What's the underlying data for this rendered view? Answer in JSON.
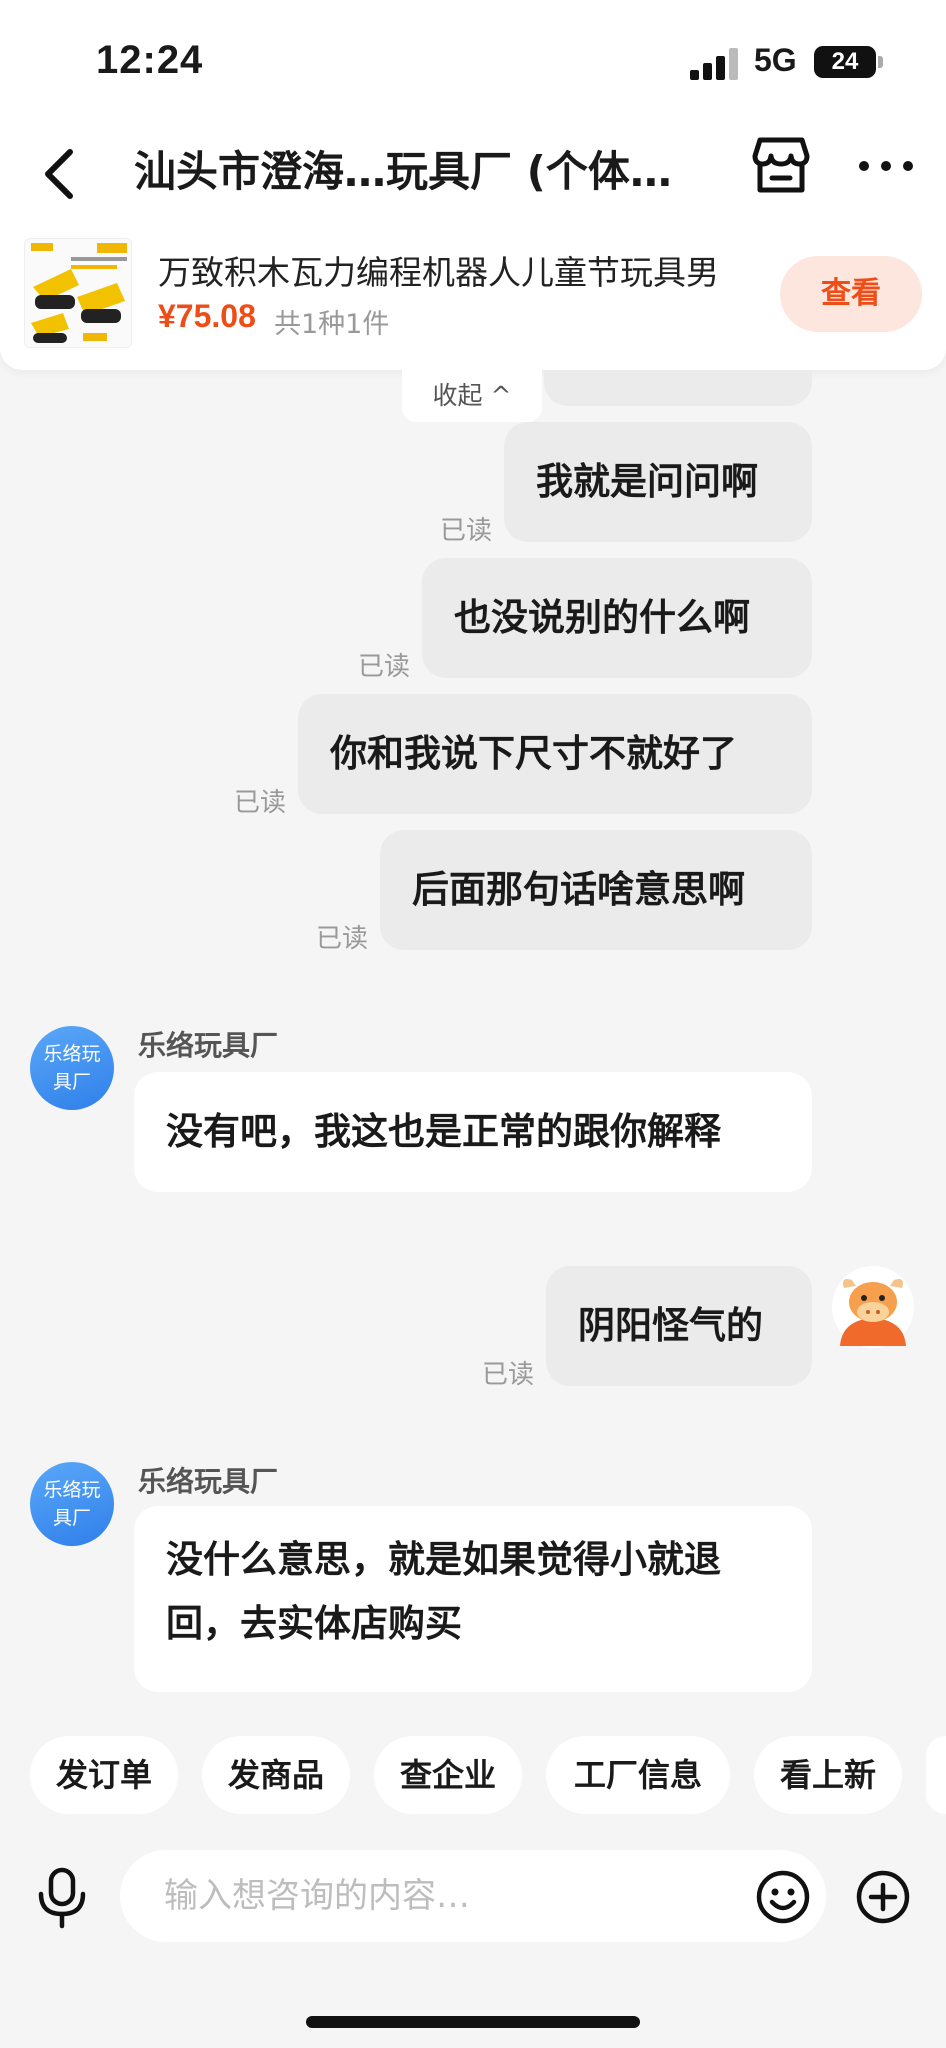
{
  "status_bar": {
    "time": "12:24",
    "network": "5G",
    "battery": "24"
  },
  "nav": {
    "title": "汕头市澄海…玩具厂 (个体…",
    "back_icon": "chevron-left-icon",
    "shop_icon": "storefront-icon",
    "more_icon": "more-dots-icon"
  },
  "product": {
    "name": "万致积木瓦力编程机器人儿童节玩具男",
    "price": "¥75.08",
    "quantity": "共1种1件",
    "view_label": "查看",
    "accent_color": "#ee4d18"
  },
  "chat": {
    "collapse_label": "收起 ^",
    "read_label": "已读",
    "messages": [
      {
        "from": "me",
        "text": "我就是问问啊",
        "status": "已读"
      },
      {
        "from": "me",
        "text": "也没说别的什么啊",
        "status": "已读"
      },
      {
        "from": "me",
        "text": "你和我说下尺寸不就好了",
        "status": "已读"
      },
      {
        "from": "me",
        "text": "后面那句话啥意思啊",
        "status": "已读"
      },
      {
        "from": "shop",
        "sender": "乐络玩具厂",
        "avatar_text": "乐络玩具厂",
        "text": "没有吧，我这也是正常的跟你解释"
      },
      {
        "from": "me",
        "text": "阴阳怪气的",
        "status": "已读"
      },
      {
        "from": "shop",
        "sender": "乐络玩具厂",
        "avatar_text": "乐络玩具厂",
        "text_line1": "没什么意思，就是如果觉得小就退",
        "text_line2": "回，去实体店购买"
      }
    ]
  },
  "shop_avatar": {
    "line1": "乐络玩",
    "line2": "具厂"
  },
  "quick_actions": [
    "发订单",
    "发商品",
    "查企业",
    "工厂信息",
    "看上新"
  ],
  "input": {
    "placeholder": "输入想咨询的内容…",
    "mic_icon": "microphone-icon",
    "emoji_icon": "smiley-icon",
    "plus_icon": "plus-circle-icon"
  }
}
